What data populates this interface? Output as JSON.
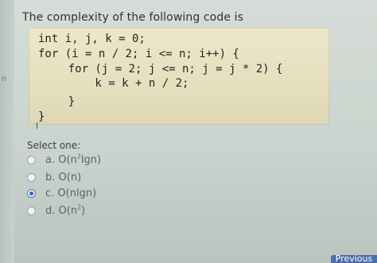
{
  "left_strip": {
    "text": "n"
  },
  "question": {
    "text": "The complexity of the following code is"
  },
  "code": {
    "lines": [
      "int i, j, k = 0;",
      "for (i = n / 2; i <= n; i++) {",
      "    for (j = 2; j <= n; j = j * 2) {",
      "        k = k + n / 2;",
      "    }",
      "}"
    ]
  },
  "select": {
    "label": "Select one:",
    "options": [
      {
        "prefix": "a.",
        "text": "O(n",
        "sup": "2",
        "suffix": "lgn)",
        "selected": false
      },
      {
        "prefix": "b.",
        "text": "O(n)",
        "sup": "",
        "suffix": "",
        "selected": false
      },
      {
        "prefix": "c.",
        "text": "O(nlgn)",
        "sup": "",
        "suffix": "",
        "selected": true
      },
      {
        "prefix": "d.",
        "text": "O(n",
        "sup": "2",
        "suffix": ")",
        "selected": false
      }
    ]
  },
  "nav": {
    "previous_label": "Previous"
  },
  "colors": {
    "selected_radio": "#2f62c2",
    "code_background": "#e6e0bf",
    "button": "#4f6fa8"
  }
}
